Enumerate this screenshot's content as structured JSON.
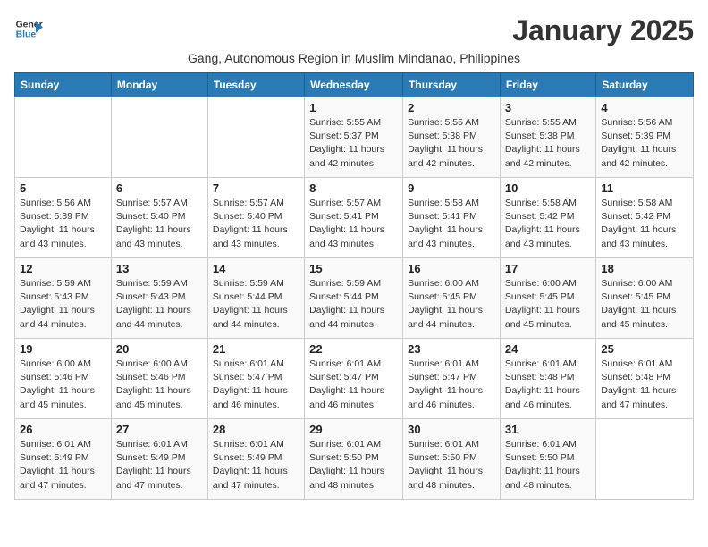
{
  "logo": {
    "line1": "General",
    "line2": "Blue"
  },
  "title": "January 2025",
  "subtitle": "Gang, Autonomous Region in Muslim Mindanao, Philippines",
  "weekdays": [
    "Sunday",
    "Monday",
    "Tuesday",
    "Wednesday",
    "Thursday",
    "Friday",
    "Saturday"
  ],
  "weeks": [
    [
      {
        "day": "",
        "info": ""
      },
      {
        "day": "",
        "info": ""
      },
      {
        "day": "",
        "info": ""
      },
      {
        "day": "1",
        "info": "Sunrise: 5:55 AM\nSunset: 5:37 PM\nDaylight: 11 hours\nand 42 minutes."
      },
      {
        "day": "2",
        "info": "Sunrise: 5:55 AM\nSunset: 5:38 PM\nDaylight: 11 hours\nand 42 minutes."
      },
      {
        "day": "3",
        "info": "Sunrise: 5:55 AM\nSunset: 5:38 PM\nDaylight: 11 hours\nand 42 minutes."
      },
      {
        "day": "4",
        "info": "Sunrise: 5:56 AM\nSunset: 5:39 PM\nDaylight: 11 hours\nand 42 minutes."
      }
    ],
    [
      {
        "day": "5",
        "info": "Sunrise: 5:56 AM\nSunset: 5:39 PM\nDaylight: 11 hours\nand 43 minutes."
      },
      {
        "day": "6",
        "info": "Sunrise: 5:57 AM\nSunset: 5:40 PM\nDaylight: 11 hours\nand 43 minutes."
      },
      {
        "day": "7",
        "info": "Sunrise: 5:57 AM\nSunset: 5:40 PM\nDaylight: 11 hours\nand 43 minutes."
      },
      {
        "day": "8",
        "info": "Sunrise: 5:57 AM\nSunset: 5:41 PM\nDaylight: 11 hours\nand 43 minutes."
      },
      {
        "day": "9",
        "info": "Sunrise: 5:58 AM\nSunset: 5:41 PM\nDaylight: 11 hours\nand 43 minutes."
      },
      {
        "day": "10",
        "info": "Sunrise: 5:58 AM\nSunset: 5:42 PM\nDaylight: 11 hours\nand 43 minutes."
      },
      {
        "day": "11",
        "info": "Sunrise: 5:58 AM\nSunset: 5:42 PM\nDaylight: 11 hours\nand 43 minutes."
      }
    ],
    [
      {
        "day": "12",
        "info": "Sunrise: 5:59 AM\nSunset: 5:43 PM\nDaylight: 11 hours\nand 44 minutes."
      },
      {
        "day": "13",
        "info": "Sunrise: 5:59 AM\nSunset: 5:43 PM\nDaylight: 11 hours\nand 44 minutes."
      },
      {
        "day": "14",
        "info": "Sunrise: 5:59 AM\nSunset: 5:44 PM\nDaylight: 11 hours\nand 44 minutes."
      },
      {
        "day": "15",
        "info": "Sunrise: 5:59 AM\nSunset: 5:44 PM\nDaylight: 11 hours\nand 44 minutes."
      },
      {
        "day": "16",
        "info": "Sunrise: 6:00 AM\nSunset: 5:45 PM\nDaylight: 11 hours\nand 44 minutes."
      },
      {
        "day": "17",
        "info": "Sunrise: 6:00 AM\nSunset: 5:45 PM\nDaylight: 11 hours\nand 45 minutes."
      },
      {
        "day": "18",
        "info": "Sunrise: 6:00 AM\nSunset: 5:45 PM\nDaylight: 11 hours\nand 45 minutes."
      }
    ],
    [
      {
        "day": "19",
        "info": "Sunrise: 6:00 AM\nSunset: 5:46 PM\nDaylight: 11 hours\nand 45 minutes."
      },
      {
        "day": "20",
        "info": "Sunrise: 6:00 AM\nSunset: 5:46 PM\nDaylight: 11 hours\nand 45 minutes."
      },
      {
        "day": "21",
        "info": "Sunrise: 6:01 AM\nSunset: 5:47 PM\nDaylight: 11 hours\nand 46 minutes."
      },
      {
        "day": "22",
        "info": "Sunrise: 6:01 AM\nSunset: 5:47 PM\nDaylight: 11 hours\nand 46 minutes."
      },
      {
        "day": "23",
        "info": "Sunrise: 6:01 AM\nSunset: 5:47 PM\nDaylight: 11 hours\nand 46 minutes."
      },
      {
        "day": "24",
        "info": "Sunrise: 6:01 AM\nSunset: 5:48 PM\nDaylight: 11 hours\nand 46 minutes."
      },
      {
        "day": "25",
        "info": "Sunrise: 6:01 AM\nSunset: 5:48 PM\nDaylight: 11 hours\nand 47 minutes."
      }
    ],
    [
      {
        "day": "26",
        "info": "Sunrise: 6:01 AM\nSunset: 5:49 PM\nDaylight: 11 hours\nand 47 minutes."
      },
      {
        "day": "27",
        "info": "Sunrise: 6:01 AM\nSunset: 5:49 PM\nDaylight: 11 hours\nand 47 minutes."
      },
      {
        "day": "28",
        "info": "Sunrise: 6:01 AM\nSunset: 5:49 PM\nDaylight: 11 hours\nand 47 minutes."
      },
      {
        "day": "29",
        "info": "Sunrise: 6:01 AM\nSunset: 5:50 PM\nDaylight: 11 hours\nand 48 minutes."
      },
      {
        "day": "30",
        "info": "Sunrise: 6:01 AM\nSunset: 5:50 PM\nDaylight: 11 hours\nand 48 minutes."
      },
      {
        "day": "31",
        "info": "Sunrise: 6:01 AM\nSunset: 5:50 PM\nDaylight: 11 hours\nand 48 minutes."
      },
      {
        "day": "",
        "info": ""
      }
    ]
  ]
}
